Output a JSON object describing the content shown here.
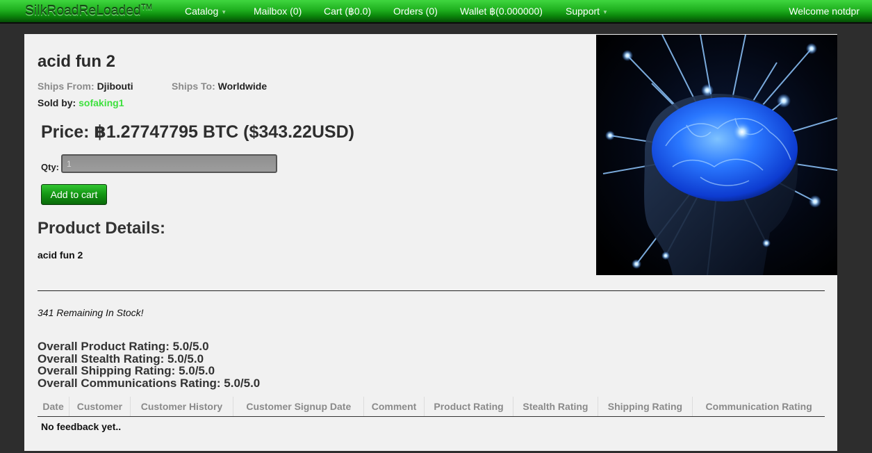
{
  "header": {
    "brand": "SilkRoadReLoaded",
    "brand_tm": "TM",
    "nav": {
      "catalog": "Catalog",
      "mailbox": "Mailbox (0)",
      "cart": "Cart (฿0.0)",
      "orders": "Orders (0)",
      "wallet": "Wallet ฿(0.000000)",
      "support": "Support"
    },
    "welcome": "Welcome notdpr"
  },
  "product": {
    "title": "acid fun 2",
    "ships_from_label": "Ships From:",
    "ships_from": "Djibouti",
    "ships_to_label": "Ships To:",
    "ships_to": "Worldwide",
    "sold_by_label": "Sold by:",
    "vendor": "sofaking1",
    "price": "Price: ฿1.27747795 BTC ($343.22USD)",
    "qty_label": "Qty:",
    "qty_value": "1",
    "add_to_cart": "Add to cart",
    "details_heading": "Product Details:",
    "details_text": "acid fun 2",
    "stock": "341 Remaining In Stock!"
  },
  "ratings": {
    "product": "Overall Product Rating: 5.0/5.0",
    "stealth": "Overall Stealth Rating: 5.0/5.0",
    "shipping": "Overall Shipping Rating: 5.0/5.0",
    "communications": "Overall Communications Rating: 5.0/5.0"
  },
  "feedback": {
    "columns": [
      "Date",
      "Customer",
      "Customer History",
      "Customer Signup Date",
      "Comment",
      "Product Rating",
      "Stealth Rating",
      "Shipping Rating",
      "Communication Rating"
    ],
    "empty": "No feedback yet.."
  },
  "colors": {
    "accent": "#1fb01f",
    "vendor": "#3ee03e",
    "page_bg": "#2d2d2d",
    "panel_bg": "#f1f1f1"
  },
  "icons": {
    "dropdown": "chevron-down-icon",
    "product_image": "glowing-brain-image"
  }
}
